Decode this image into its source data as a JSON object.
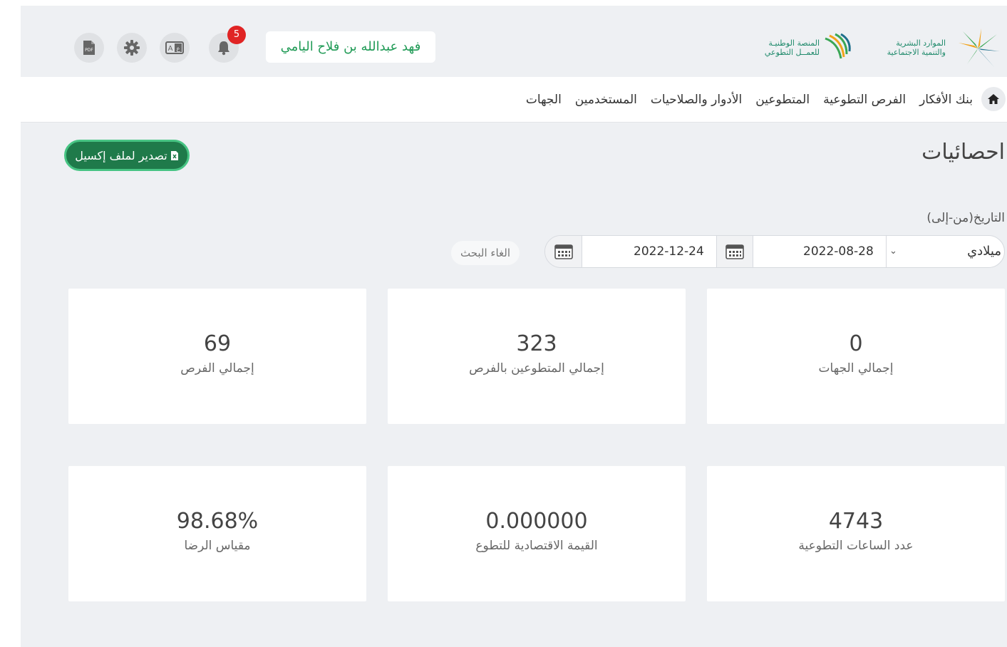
{
  "header": {
    "logo_primary_line1": "الموارد البشرية",
    "logo_primary_line2": "والتنمية الاجتماعية",
    "logo_secondary_line1": "المنصة الوطنيـة",
    "logo_secondary_line2": "للعمــل التطوعي",
    "user_name": "فهد عبدالله بن فلاح اليامي",
    "notification_count": "5",
    "icons": [
      "bell-icon",
      "language-icon",
      "gear-icon",
      "pdf-icon"
    ]
  },
  "nav": {
    "items": [
      "الجهات",
      "المستخدمين",
      "الأدوار والصلاحيات",
      "المتطوعين",
      "الفرص التطوعية",
      "بنك الأفكار"
    ]
  },
  "page": {
    "title": "احصائيات",
    "export_label": "تصدير لملف إكسيل",
    "date_label": "التاريخ(من-إلى)",
    "calendar_type": "ميلادي",
    "date_from": "2022-08-28",
    "date_to": "2022-12-24",
    "clear_label": "الغاء البحث"
  },
  "stats": [
    {
      "value": "0",
      "label": "إجمالي الجهات"
    },
    {
      "value": "323",
      "label": "إجمالي المتطوعين بالفرص"
    },
    {
      "value": "69",
      "label": "إجمالي الفرص"
    },
    {
      "value": "4743",
      "label": "عدد الساعات التطوعية"
    },
    {
      "value": "0.000000",
      "label": "القيمة الاقتصادية للتطوع"
    },
    {
      "value": "98.68%",
      "label": "مقياس الرضا"
    }
  ],
  "colors": {
    "accent": "#1f7a4a",
    "accent_border": "#47c483",
    "badge": "#e02424",
    "username_text": "#1f9a55"
  }
}
